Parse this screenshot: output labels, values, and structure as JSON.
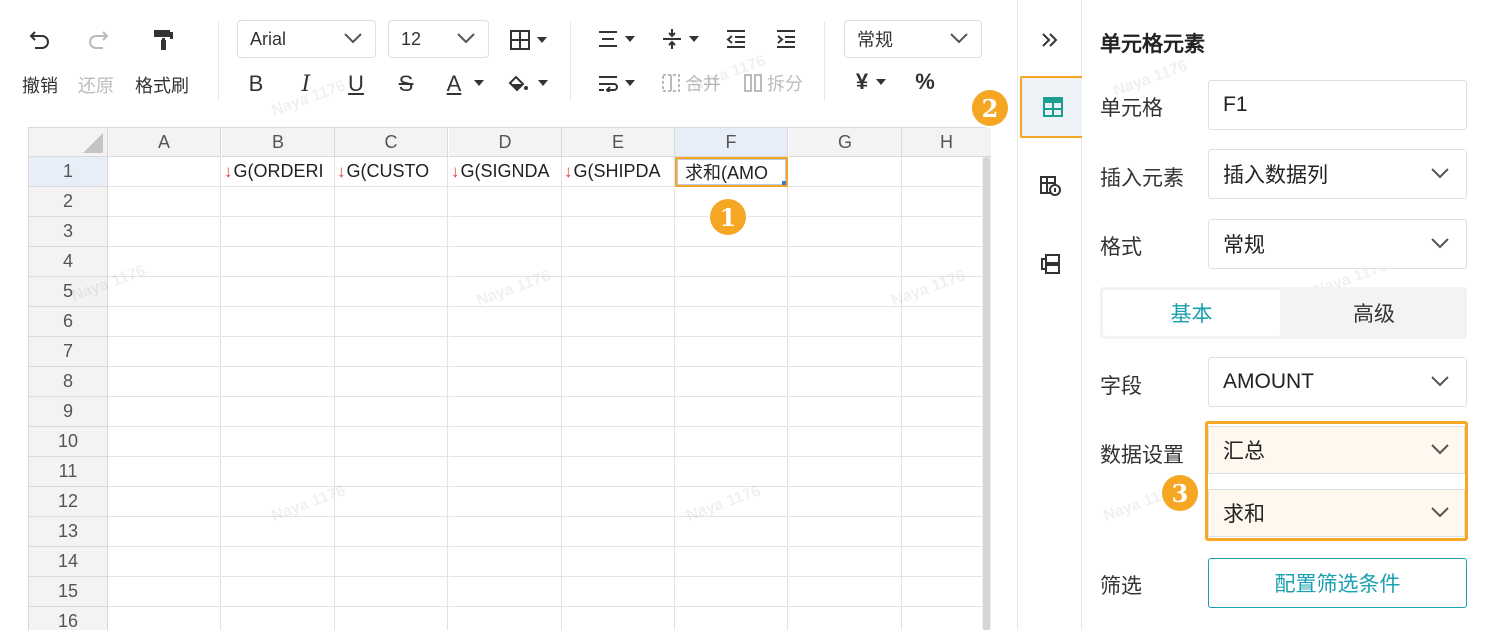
{
  "toolbar": {
    "undo_label": "撤销",
    "redo_label": "还原",
    "format_painter_label": "格式刷",
    "font_family": "Arial",
    "font_size": "12",
    "bold": "B",
    "italic": "I",
    "underline": "U",
    "strike": "S",
    "font_color": "A",
    "merge_label": "合并",
    "split_label": "拆分",
    "number_format": "常规",
    "currency": "¥",
    "percent": "%"
  },
  "sheet": {
    "columns": [
      "A",
      "B",
      "C",
      "D",
      "E",
      "F",
      "G",
      "H"
    ],
    "rows": [
      "1",
      "2",
      "3",
      "4",
      "5",
      "6",
      "7",
      "8",
      "9",
      "10",
      "11",
      "12",
      "13",
      "14",
      "15",
      "16"
    ],
    "row1": {
      "B": "G(ORDERI",
      "C": "G(CUSTO",
      "D": "G(SIGNDA",
      "E": "G(SHIPDA",
      "F": "求和(AMO"
    },
    "down_arrow": "↓",
    "selected_col": "F",
    "selected_row": "1"
  },
  "badges": {
    "one": "1",
    "two": "2",
    "three": "3"
  },
  "watermark": "Naya 1176",
  "rail": {
    "collapse_icon": "double-chevron-right-icon",
    "cell_element_icon": "cell-element-icon",
    "cell_attr_icon": "cell-attribute-icon",
    "widget_icon": "widget-icon"
  },
  "panel": {
    "title": "单元格元素",
    "cell_label": "单元格",
    "cell_value": "F1",
    "insert_label": "插入元素",
    "insert_value": "插入数据列",
    "format_label": "格式",
    "format_value": "常规",
    "tab_basic": "基本",
    "tab_advanced": "高级",
    "field_label": "字段",
    "field_value": "AMOUNT",
    "data_setting_label": "数据设置",
    "data_setting_value": "汇总",
    "aggregate_value": "求和",
    "filter_label": "筛选",
    "filter_button": "配置筛选条件"
  },
  "colors": {
    "accent": "#1aa0b0",
    "highlight": "#f5a623",
    "arrow_red": "#e03b3b"
  }
}
